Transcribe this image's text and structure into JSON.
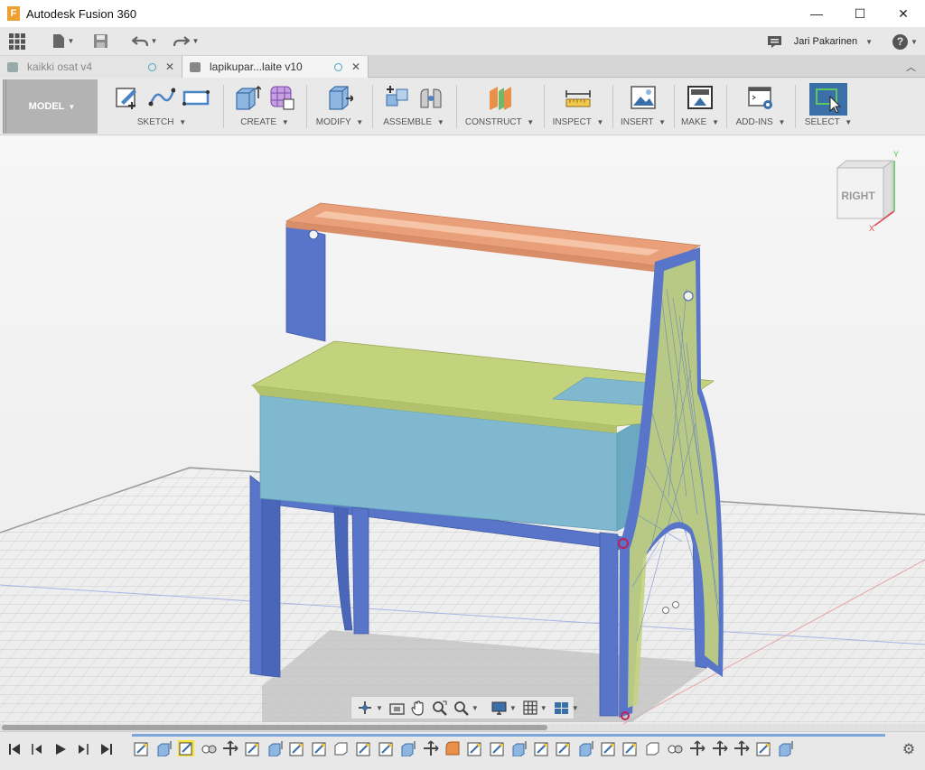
{
  "window": {
    "title": "Autodesk Fusion 360",
    "minimize": "—",
    "maximize": "☐",
    "close": "✕"
  },
  "quickbar": {
    "user_name": "Jari Pakarinen",
    "help": "?"
  },
  "tabs": [
    {
      "label": "kaikki osat v4",
      "active": false
    },
    {
      "label": "lapikupar...laite v10",
      "active": true
    }
  ],
  "toolbar": {
    "workspace": "MODEL",
    "groups": [
      {
        "label": "SKETCH",
        "icons": [
          "sketch-create-icon",
          "spline-icon",
          "rectangle-icon"
        ]
      },
      {
        "label": "CREATE",
        "icons": [
          "extrude-box-icon",
          "form-cage-icon"
        ]
      },
      {
        "label": "MODIFY",
        "icons": [
          "press-pull-icon"
        ]
      },
      {
        "label": "ASSEMBLE",
        "icons": [
          "new-component-icon",
          "joint-icon"
        ]
      },
      {
        "label": "CONSTRUCT",
        "icons": [
          "construct-plane-icon"
        ]
      },
      {
        "label": "INSPECT",
        "icons": [
          "measure-icon"
        ]
      },
      {
        "label": "INSERT",
        "icons": [
          "insert-image-icon"
        ]
      },
      {
        "label": "MAKE",
        "icons": [
          "3d-print-icon"
        ]
      },
      {
        "label": "ADD-INS",
        "icons": [
          "scripts-icon"
        ]
      },
      {
        "label": "SELECT",
        "icons": [
          "select-window-icon"
        ]
      }
    ]
  },
  "viewcube": {
    "face_label": "RIGHT",
    "axis_y": "Y",
    "axis_x": "X"
  },
  "colors": {
    "plate_orange": "#e9a07a",
    "frame_blue": "#5875c9",
    "tank_blue": "#7fb8cf",
    "top_green": "#c3d37d",
    "select_blue": "#3b6fa8"
  }
}
